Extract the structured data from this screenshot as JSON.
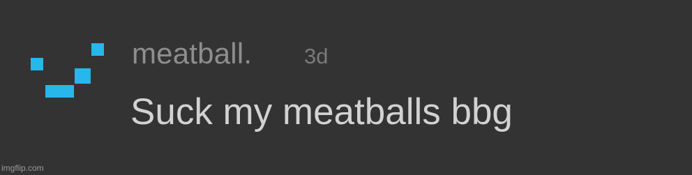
{
  "comment": {
    "username": "meatball.",
    "timestamp": "3d",
    "message": "Suck my meatballs bbg",
    "avatar_icon": "pixel-smile-icon",
    "avatar_color": "#27b7ea"
  },
  "watermark": "imgflip.com",
  "colors": {
    "background": "#333333",
    "username": "#8e8e8e",
    "timestamp": "#7a7a7a",
    "message": "#d2d2d2"
  }
}
